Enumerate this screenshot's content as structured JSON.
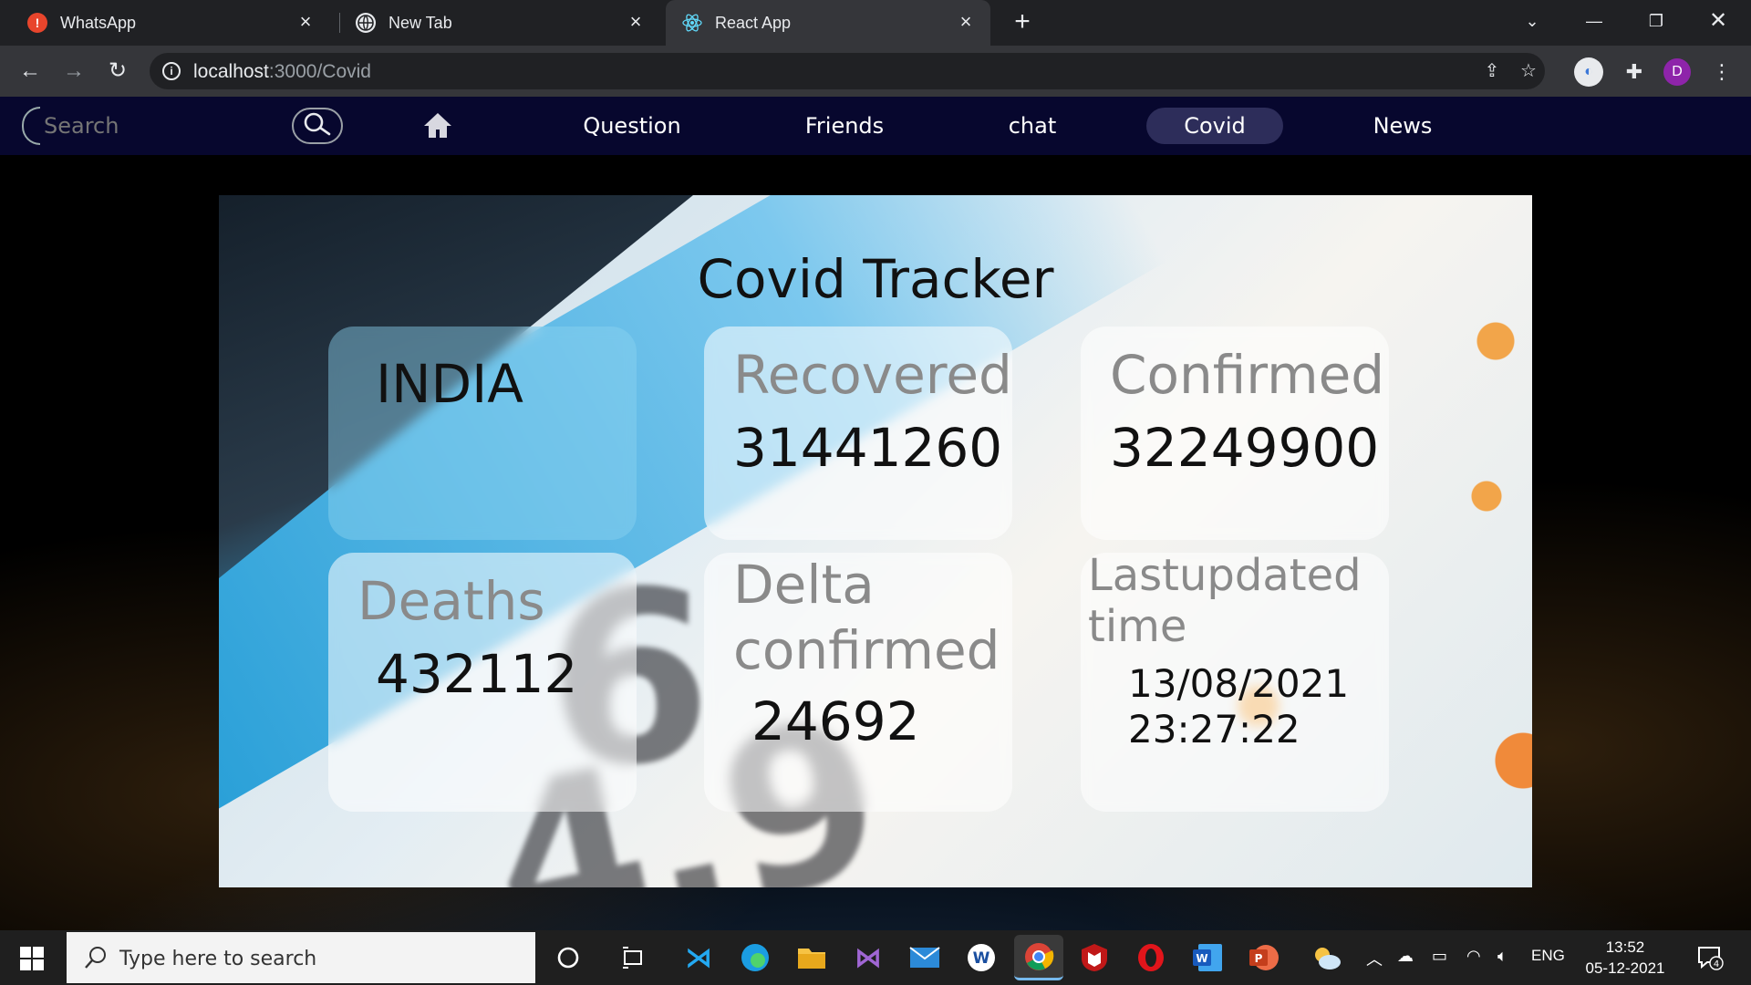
{
  "browser": {
    "tabs": [
      {
        "title": "WhatsApp",
        "active": false
      },
      {
        "title": "New Tab",
        "active": false
      },
      {
        "title": "React App",
        "active": true
      }
    ],
    "url_host": "localhost",
    "url_path": ":3000/Covid",
    "profile_initial": "D"
  },
  "nav": {
    "search_placeholder": "Search",
    "links": [
      "Question",
      "Friends",
      "chat",
      "Covid",
      "News"
    ],
    "active_link": "Covid"
  },
  "tracker": {
    "title": "Covid Tracker",
    "country": "INDIA",
    "recovered": {
      "label": "Recovered",
      "value": "31441260"
    },
    "confirmed": {
      "label": "Confirmed",
      "value": "32249900"
    },
    "deaths": {
      "label": "Deaths",
      "value": "432112"
    },
    "delta": {
      "label_line1": "Delta",
      "label_line2": "confirmed",
      "value": "24692"
    },
    "updated": {
      "label_line1": "Lastupdated",
      "label_line2": "time",
      "date": "13/08/2021",
      "time": "23:27:22"
    }
  },
  "taskbar": {
    "search_placeholder": "Type here to search",
    "language": "ENG",
    "time": "13:52",
    "date": "05-12-2021",
    "notifications": "4"
  },
  "colors": {
    "chrome_dark": "#202124",
    "chrome_toolbar": "#35363a",
    "app_nav": "#07072e",
    "active_nav_pill": "#2d2d5a"
  }
}
